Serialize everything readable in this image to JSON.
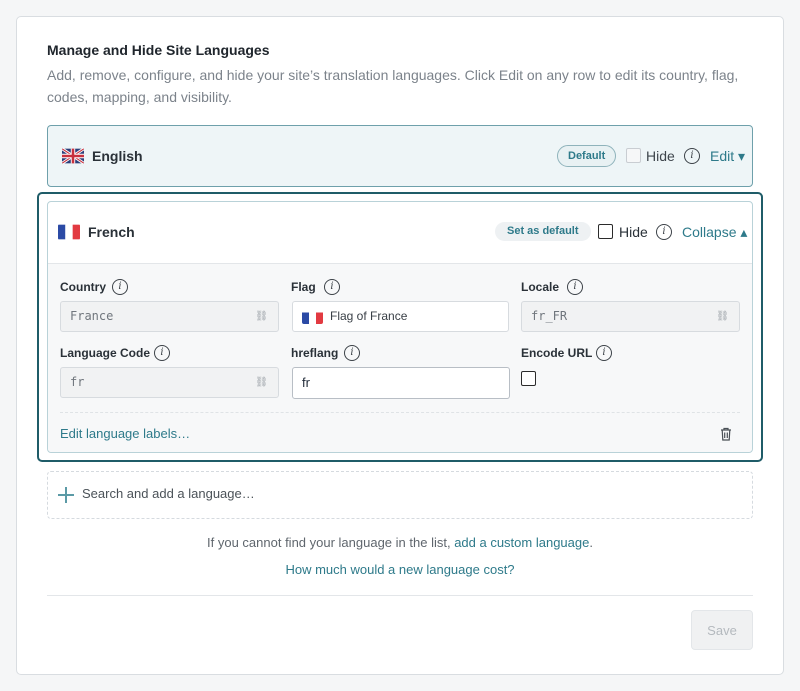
{
  "section": {
    "title": "Manage and Hide Site Languages",
    "description": "Add, remove, configure, and hide your site’s translation languages. Click Edit on any row to edit its country, flag, codes, mapping, and visibility."
  },
  "languages": [
    {
      "name": "English",
      "flag_icon": "uk-flag-icon",
      "badge": "Default",
      "hide_label": "Hide",
      "hidden": false,
      "action_label": "Edit ▾"
    },
    {
      "name": "French",
      "flag_icon": "france-flag-icon",
      "badge": "Set as default",
      "hide_label": "Hide",
      "hidden": false,
      "action_label": "Collapse ▴",
      "fields": {
        "country": {
          "label": "Country",
          "value": "France"
        },
        "flag": {
          "label": "Flag",
          "value": "Flag of France"
        },
        "locale": {
          "label": "Locale",
          "value": "fr_FR"
        },
        "language_code": {
          "label": "Language Code",
          "value": "fr"
        },
        "hreflang": {
          "label": "hreflang",
          "value": "fr"
        },
        "encode_url": {
          "label": "Encode URL",
          "checked": false
        }
      },
      "edit_labels_link": "Edit language labels…"
    }
  ],
  "add_language": {
    "placeholder": "Search and add a language…"
  },
  "help": {
    "custom_prefix": "If you cannot find your language in the list,",
    "custom_link": "add a custom language",
    "custom_suffix": ".",
    "cost_link": "How much would a new language cost?"
  },
  "save_label": "Save",
  "colors": {
    "accent": "#2e7a8a",
    "focus": "#1f5c68",
    "selected_bg": "#eef5f7"
  }
}
